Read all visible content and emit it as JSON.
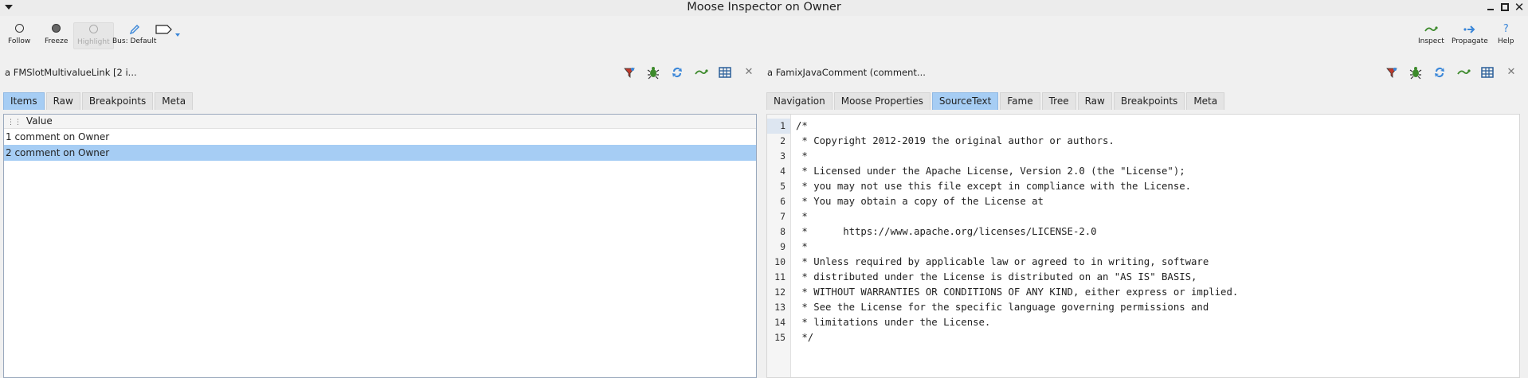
{
  "window": {
    "title": "Moose Inspector on Owner"
  },
  "toolbar": {
    "follow": "Follow",
    "freeze": "Freeze",
    "highlight": "Highlight",
    "bus": "Bus: Default",
    "inspect": "Inspect",
    "propagate": "Propagate",
    "help": "Help"
  },
  "left": {
    "title": "a FMSlotMultivalueLink [2 i...",
    "tabs": [
      "Items",
      "Raw",
      "Breakpoints",
      "Meta"
    ],
    "active_tab": "Items",
    "column": "Value",
    "rows": [
      "1 comment on Owner",
      "2 comment on Owner"
    ],
    "selected_row": 1
  },
  "right": {
    "title": "a FamixJavaComment (comment...",
    "tabs": [
      "Navigation",
      "Moose Properties",
      "SourceText",
      "Fame",
      "Tree",
      "Raw",
      "Breakpoints",
      "Meta"
    ],
    "active_tab": "SourceText",
    "line_numbers": [
      "1",
      "2",
      "3",
      "4",
      "5",
      "6",
      "7",
      "8",
      "9",
      "10",
      "11",
      "12",
      "13",
      "14",
      "15"
    ],
    "lines": [
      "/*",
      " * Copyright 2012-2019 the original author or authors.",
      " *",
      " * Licensed under the Apache License, Version 2.0 (the \"License\");",
      " * you may not use this file except in compliance with the License.",
      " * You may obtain a copy of the License at",
      " *",
      " *      https://www.apache.org/licenses/LICENSE-2.0",
      " *",
      " * Unless required by applicable law or agreed to in writing, software",
      " * distributed under the License is distributed on an \"AS IS\" BASIS,",
      " * WITHOUT WARRANTIES OR CONDITIONS OF ANY KIND, either express or implied.",
      " * See the License for the specific language governing permissions and",
      " * limitations under the License.",
      " */"
    ]
  },
  "colors": {
    "tab_active": "#a6cdf4",
    "row_selected": "#a6cdf4",
    "accent_blue": "#3a86d8",
    "bug_green": "#3d8a2c"
  },
  "icons": {
    "pane_actions": [
      "filter-icon",
      "debug-icon",
      "refresh-icon",
      "inspect-icon",
      "table-icon",
      "close-icon"
    ]
  }
}
